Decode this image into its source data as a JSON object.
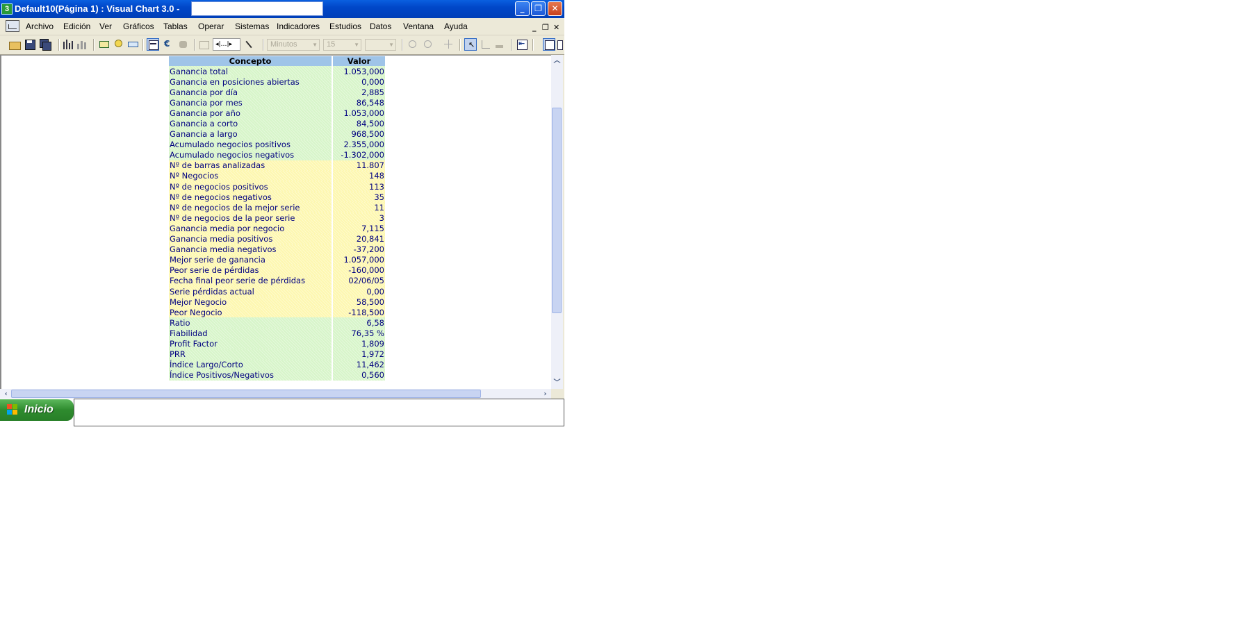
{
  "window": {
    "title": "Default10(Página 1) : Visual Chart  3.0 -",
    "app_icon_text": "3",
    "controls": {
      "minimize": "_",
      "restore": "❐",
      "close": "✕"
    }
  },
  "menubar": {
    "items": [
      "Archivo",
      "Edición",
      "Ver",
      "Gráficos",
      "Tablas",
      "Operar",
      "Sistemas",
      "Indicadores",
      "Estudios",
      "Datos",
      "Ventana",
      "Ayuda"
    ],
    "mdi_controls": {
      "minimize": "_",
      "restore": "❐",
      "close": "✕"
    }
  },
  "toolbar": {
    "period_combo": "Minutos",
    "interval_combo": "15",
    "extra_combo": ""
  },
  "table": {
    "headers": [
      "Concepto",
      "Valor"
    ],
    "rows": [
      {
        "concept": "Ganancia total",
        "value": "1.053,000",
        "tone": "green"
      },
      {
        "concept": "Ganancia en posiciones abiertas",
        "value": "0,000",
        "tone": "green"
      },
      {
        "concept": "Ganancia por día",
        "value": "2,885",
        "tone": "green"
      },
      {
        "concept": "Ganancia por mes",
        "value": "86,548",
        "tone": "green"
      },
      {
        "concept": "Ganancia por año",
        "value": "1.053,000",
        "tone": "green"
      },
      {
        "concept": "Ganancia a corto",
        "value": "84,500",
        "tone": "green"
      },
      {
        "concept": "Ganancia a largo",
        "value": "968,500",
        "tone": "green"
      },
      {
        "concept": "Acumulado negocios positivos",
        "value": "2.355,000",
        "tone": "green"
      },
      {
        "concept": "Acumulado negocios negativos",
        "value": "-1.302,000",
        "tone": "green"
      },
      {
        "concept": "Nº de barras analizadas",
        "value": "11.807",
        "tone": "yellow"
      },
      {
        "concept": "Nº Negocios",
        "value": "148",
        "tone": "yellow"
      },
      {
        "concept": "Nº de negocios positivos",
        "value": "113",
        "tone": "yellow"
      },
      {
        "concept": "Nº de negocios negativos",
        "value": "35",
        "tone": "yellow"
      },
      {
        "concept": "Nº de negocios de la mejor serie",
        "value": "11",
        "tone": "yellow"
      },
      {
        "concept": "Nº de negocios de la peor serie",
        "value": "3",
        "tone": "yellow"
      },
      {
        "concept": "Ganancia media por negocio",
        "value": "7,115",
        "tone": "yellow"
      },
      {
        "concept": "Ganancia media positivos",
        "value": "20,841",
        "tone": "yellow"
      },
      {
        "concept": "Ganancia media negativos",
        "value": "-37,200",
        "tone": "yellow"
      },
      {
        "concept": "Mejor serie de ganancia",
        "value": "1.057,000",
        "tone": "yellow"
      },
      {
        "concept": "Peor serie de pérdidas",
        "value": "-160,000",
        "tone": "yellow"
      },
      {
        "concept": "Fecha final peor serie de pérdidas",
        "value": "02/06/05",
        "tone": "yellow"
      },
      {
        "concept": "Serie pérdidas actual",
        "value": "0,00",
        "tone": "yellow"
      },
      {
        "concept": "Mejor Negocio",
        "value": "58,500",
        "tone": "yellow"
      },
      {
        "concept": "Peor Negocio",
        "value": "-118,500",
        "tone": "yellow"
      },
      {
        "concept": "Ratio",
        "value": "6,58",
        "tone": "green"
      },
      {
        "concept": "Fiabilidad",
        "value": "76,35 %",
        "tone": "green"
      },
      {
        "concept": "Profit Factor",
        "value": "1,809",
        "tone": "green"
      },
      {
        "concept": "PRR",
        "value": "1,972",
        "tone": "green"
      },
      {
        "concept": "Índice Largo/Corto",
        "value": "11,462",
        "tone": "green"
      },
      {
        "concept": "Índice Positivos/Negativos",
        "value": "0,560",
        "tone": "green"
      }
    ]
  },
  "taskbar": {
    "start_label": "Inicio"
  },
  "colors": {
    "header_bg": "#9fc4e8",
    "row_green": "#d7f5c9",
    "row_yellow": "#fdf7b0",
    "text_navy": "#000080",
    "titlebar_blue": "#0047c8",
    "start_green": "#2e8b2e"
  }
}
